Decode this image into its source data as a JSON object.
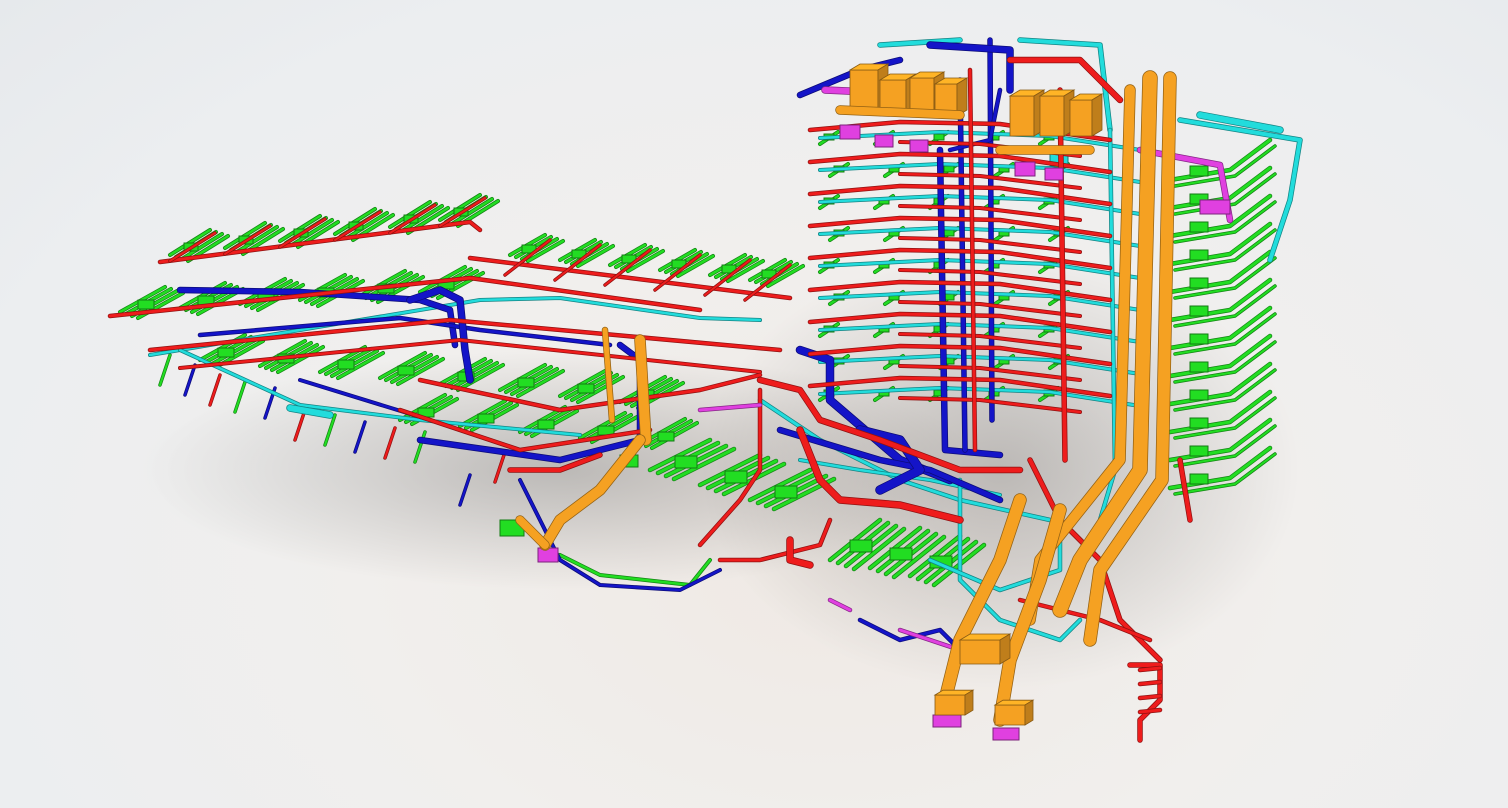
{
  "viewport": {
    "background": "#eeeeee"
  },
  "model": {
    "systems": [
      {
        "key": "heating-supply",
        "color": "#ee1c1c"
      },
      {
        "key": "heating-return",
        "color": "#1414c8"
      },
      {
        "key": "ventilation",
        "color": "#22dd22"
      },
      {
        "key": "domestic-water",
        "color": "#22dcdc"
      },
      {
        "key": "drainage",
        "color": "#f5a122"
      },
      {
        "key": "fittings",
        "color": "#e040e0"
      }
    ]
  }
}
